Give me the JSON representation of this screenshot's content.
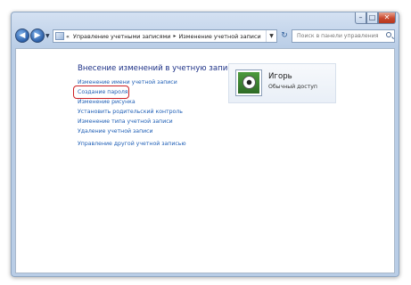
{
  "window": {
    "controls": {
      "minimize": "–",
      "maximize": "□",
      "close": "✕"
    }
  },
  "toolbar": {
    "back_glyph": "◀",
    "forward_glyph": "▶",
    "recent_dropdown": "▼",
    "address": {
      "nav_marker": "«",
      "breadcrumbs": [
        "Управление учетными записями",
        "Изменение учетной записи"
      ],
      "separator": "▸",
      "dropdown": "▼"
    },
    "refresh_glyph": "↻",
    "search_placeholder": "Поиск в панели управления"
  },
  "main": {
    "heading": "Внесение изменений в учетную запись Игорь",
    "links": [
      "Изменение имени учетной записи",
      "Создание пароля",
      "Изменение рисунка",
      "Установить родительский контроль",
      "Изменение типа учетной записи",
      "Удаление учетной записи"
    ],
    "other_account_link": "Управление другой учетной записью",
    "highlighted_link_index": 1,
    "highlight_color": "#cc1f24"
  },
  "account_card": {
    "name": "Игорь",
    "role": "Обычный доступ",
    "avatar_icon": "soccer-ball-picture"
  }
}
